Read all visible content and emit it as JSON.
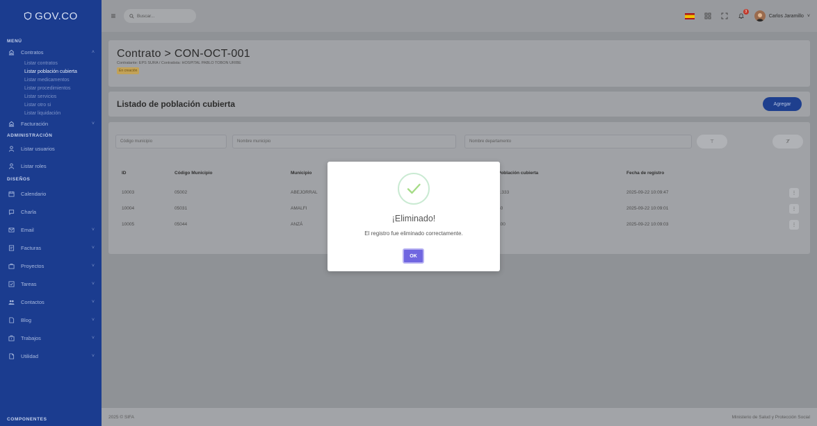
{
  "brand": {
    "name": "GOV.CO"
  },
  "sidebar": {
    "sections": {
      "menu": "MENÚ",
      "admin": "ADMINISTRACIÓN",
      "designs": "DISEÑOS",
      "components": "COMPONENTES"
    },
    "contratos": {
      "label": "Contratos",
      "subitems": [
        "Listar contratos",
        "Listar población cubierta",
        "Listar medicamentos",
        "Listar procedimientos",
        "Listar servicios",
        "Listar otro si",
        "Listar liquidación"
      ],
      "active_index": 1
    },
    "facturacion": "Facturación",
    "admin_items": [
      "Listar usuarios",
      "Listar roles"
    ],
    "design_items": [
      {
        "label": "Calendario",
        "icon": "calendar-icon",
        "chevron": false
      },
      {
        "label": "Charla",
        "icon": "chat-icon",
        "chevron": false
      },
      {
        "label": "Email",
        "icon": "email-icon",
        "chevron": true
      },
      {
        "label": "Facturas",
        "icon": "invoice-icon",
        "chevron": true
      },
      {
        "label": "Proyectos",
        "icon": "projects-icon",
        "chevron": true
      },
      {
        "label": "Tareas",
        "icon": "tasks-icon",
        "chevron": true
      },
      {
        "label": "Contactos",
        "icon": "contacts-icon",
        "chevron": true
      },
      {
        "label": "Blog",
        "icon": "blog-icon",
        "chevron": true
      },
      {
        "label": "Trabajos",
        "icon": "jobs-icon",
        "chevron": true
      },
      {
        "label": "Utilidad",
        "icon": "utility-icon",
        "chevron": true
      }
    ]
  },
  "topbar": {
    "search_placeholder": "Buscar...",
    "notification_count": "3",
    "user_name": "Carlos Jaramillo"
  },
  "contract": {
    "title": "Contrato > CON-OCT-001",
    "meta": "Contratante: EPS SURA / Contratista: HOSPITAL PABLO TOBON URIBE",
    "status": "En creación"
  },
  "list": {
    "title": "Listado de población cubierta",
    "add_label": "Agregar",
    "filters": {
      "codigo_municipio": "Código municipio",
      "nombre_municipio": "Nombre municipio",
      "nombre_departamento": "Nombre departamento"
    },
    "columns": [
      "ID",
      "Código Municipio",
      "Municipio",
      "Población cubierta",
      "Fecha de registro"
    ],
    "rows": [
      {
        "id": "10003",
        "codigo": "05002",
        "municipio": "ABEJORRAL",
        "poblacion": "2.333",
        "fecha": "2025-09-22 10:09:47"
      },
      {
        "id": "10004",
        "codigo": "05031",
        "municipio": "AMALFI",
        "poblacion": "40",
        "fecha": "2025-09-22 10:09:01"
      },
      {
        "id": "10005",
        "codigo": "05044",
        "municipio": "ANZÁ",
        "poblacion": "100",
        "fecha": "2025-09-22 10:09:03"
      }
    ]
  },
  "footer": {
    "left": "2025 © SIFA",
    "right": "Ministerio de Salud y Protección Social"
  },
  "modal": {
    "title": "¡Eliminado!",
    "message": "El registro fue eliminado correctamente.",
    "ok_label": "OK",
    "accent": "#7066e0",
    "success": "#a5dc86"
  }
}
